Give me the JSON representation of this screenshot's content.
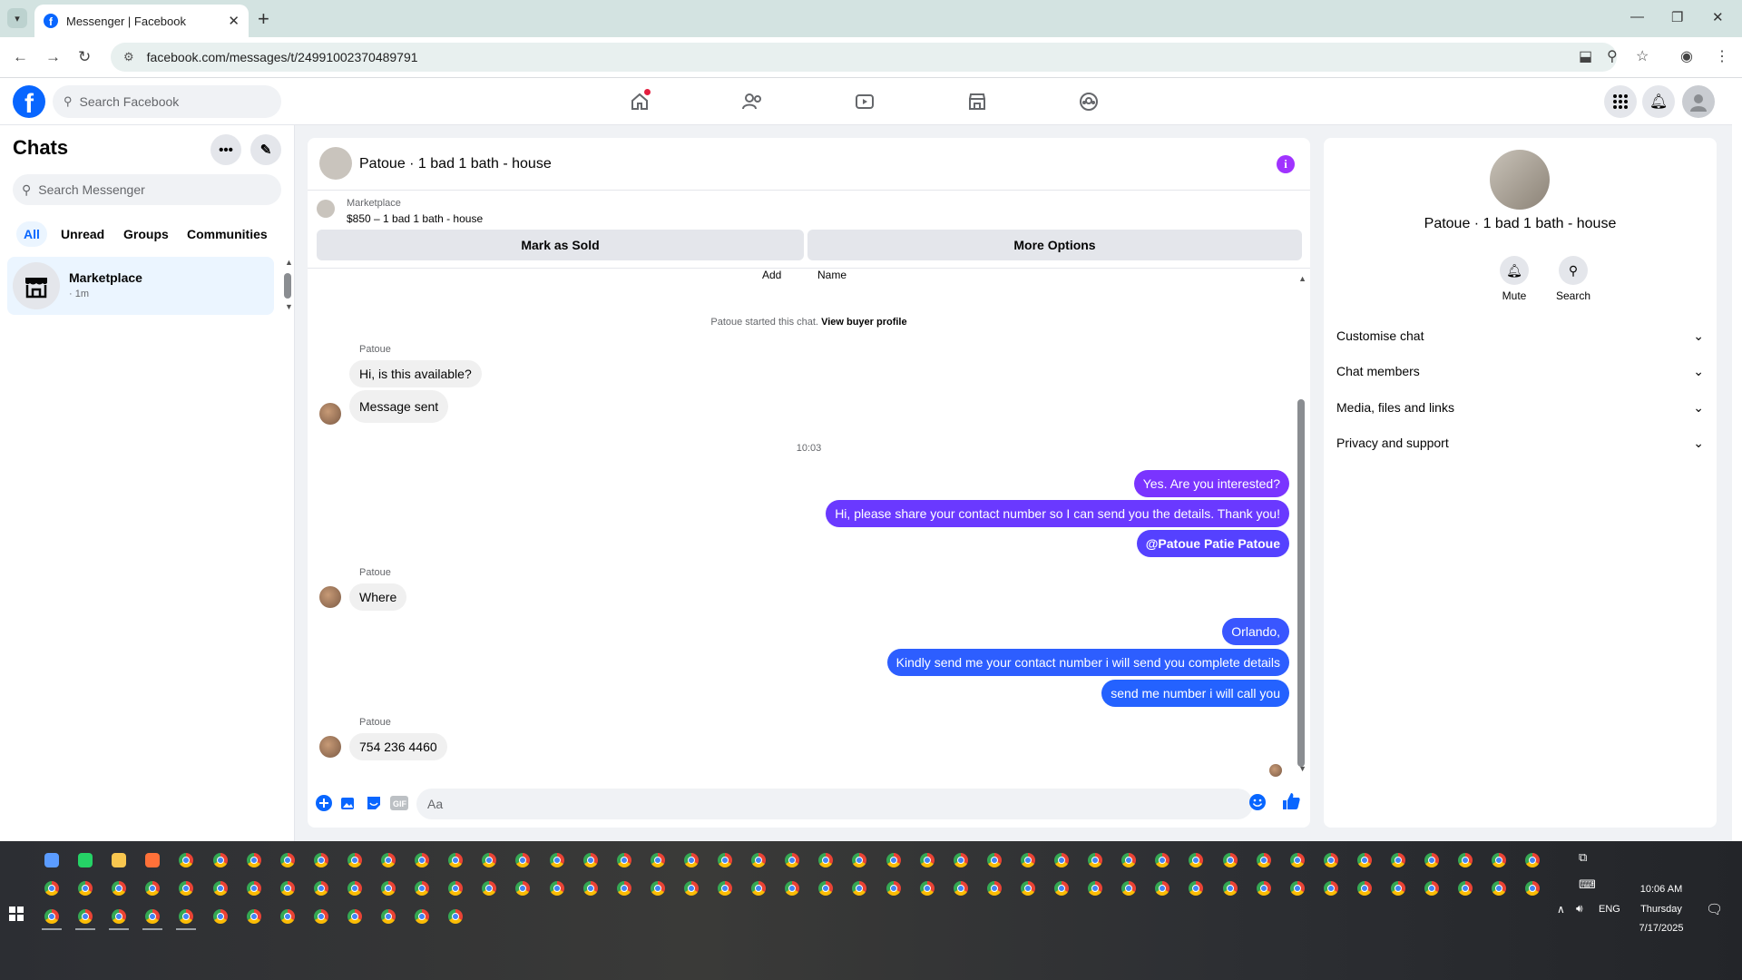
{
  "browser": {
    "tab_title": "Messenger | Facebook",
    "url": "facebook.com/messages/t/24991002370489791"
  },
  "fb": {
    "search_placeholder": "Search Facebook"
  },
  "chats": {
    "title": "Chats",
    "search_placeholder": "Search Messenger",
    "filters": [
      "All",
      "Unread",
      "Groups",
      "Communities"
    ],
    "items": [
      {
        "name": "Marketplace",
        "time": "· 1m"
      }
    ]
  },
  "conversation": {
    "title": "Patoue · 1 bad 1 bath - house",
    "marketplace_label": "Marketplace",
    "listing": "$850 – 1 bad 1 bath - house",
    "mark_sold_label": "Mark as Sold",
    "more_options_label": "More Options",
    "cut_labels": [
      "Add",
      "Name"
    ],
    "started_text": "Patoue started this chat.",
    "view_buyer_label": "View buyer profile",
    "composer_placeholder": "Aa",
    "messages": [
      {
        "sender": "Patoue",
        "text": "Hi, is this available?"
      },
      {
        "text": "Message sent"
      },
      {
        "time": "10:03"
      },
      {
        "out": true,
        "text": "Yes. Are you interested?"
      },
      {
        "out": true,
        "text": "Hi, please share your contact number so I can send you the details. Thank you!"
      },
      {
        "out": true,
        "text": "@Patoue Patie Patoue"
      },
      {
        "sender": "Patoue",
        "text": "Where"
      },
      {
        "out": true,
        "text": "Orlando,"
      },
      {
        "out": true,
        "text": "Kindly send me your contact number i will send you complete details"
      },
      {
        "out": true,
        "text": "send me number i will call you"
      },
      {
        "sender": "Patoue",
        "text": "754 236 4460"
      }
    ]
  },
  "info_panel": {
    "title": "Patoue · 1 bad 1 bath - house",
    "mute_label": "Mute",
    "search_label": "Search",
    "sections": [
      "Customise chat",
      "Chat members",
      "Media, files and links",
      "Privacy and support"
    ]
  },
  "taskbar": {
    "time": "10:06 AM",
    "day": "Thursday",
    "date": "7/17/2025",
    "lang": "ENG"
  },
  "colors": {
    "fb_blue": "#0866ff",
    "bubble_purple": "#7a34ff",
    "bubble_indigo": "#5541ff",
    "bubble_blue": "#2d5eff",
    "info_purple": "#a033ff"
  }
}
